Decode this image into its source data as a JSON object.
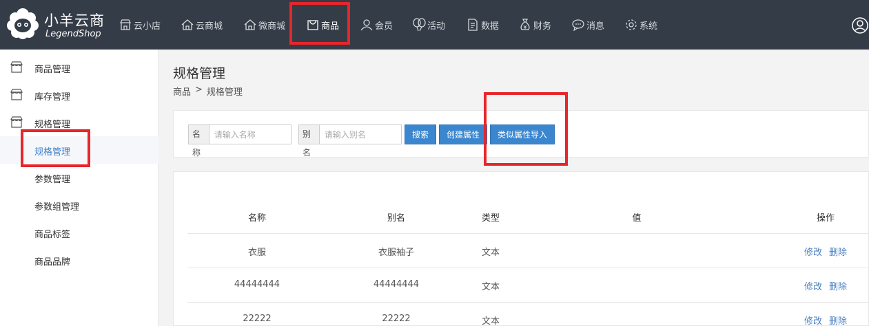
{
  "brand": {
    "name_cn": "小羊云商",
    "name_en": "LegendShop"
  },
  "nav": [
    {
      "label": "云小店",
      "icon": "store-icon"
    },
    {
      "label": "云商城",
      "icon": "home-icon"
    },
    {
      "label": "微商城",
      "icon": "home-outline-icon"
    },
    {
      "label": "商品",
      "icon": "bag-icon",
      "active": true
    },
    {
      "label": "会员",
      "icon": "user-icon"
    },
    {
      "label": "活动",
      "icon": "balloon-icon"
    },
    {
      "label": "数据",
      "icon": "document-icon"
    },
    {
      "label": "财务",
      "icon": "money-bag-icon"
    },
    {
      "label": "消息",
      "icon": "chat-icon"
    },
    {
      "label": "系统",
      "icon": "gear-icon"
    }
  ],
  "sidebar": {
    "groups": [
      {
        "label": "商品管理",
        "icon": "shop-icon"
      },
      {
        "label": "库存管理",
        "icon": "shop-icon"
      },
      {
        "label": "规格管理",
        "icon": "shop-icon"
      }
    ],
    "items": [
      {
        "label": "规格管理",
        "active": true
      },
      {
        "label": "参数管理"
      },
      {
        "label": "参数组管理"
      },
      {
        "label": "商品标签"
      },
      {
        "label": "商品品牌"
      }
    ]
  },
  "page": {
    "title": "规格管理",
    "breadcrumb": [
      "商品",
      ">",
      "规格管理"
    ]
  },
  "search": {
    "name_label": "名称",
    "name_placeholder": "请输入名称",
    "alias_label": "别名",
    "alias_placeholder": "请输入别名",
    "search_button": "搜索",
    "create_button": "创建属性",
    "import_button": "类似属性导入"
  },
  "table": {
    "columns": [
      "名称",
      "别名",
      "类型",
      "值",
      "操作"
    ],
    "rows": [
      {
        "name": "衣服",
        "alias": "衣服袖子",
        "type": "文本",
        "value": ""
      },
      {
        "name": "44444444",
        "alias": "44444444",
        "type": "文本",
        "value": ""
      },
      {
        "name": "22222",
        "alias": "22222",
        "type": "文本",
        "value": ""
      }
    ],
    "edit_label": "修改",
    "delete_label": "删除"
  },
  "colors": {
    "topbar": "#343c47",
    "accent": "#3a86cf",
    "highlight": "#e8262a",
    "link": "#4a7fc1"
  }
}
